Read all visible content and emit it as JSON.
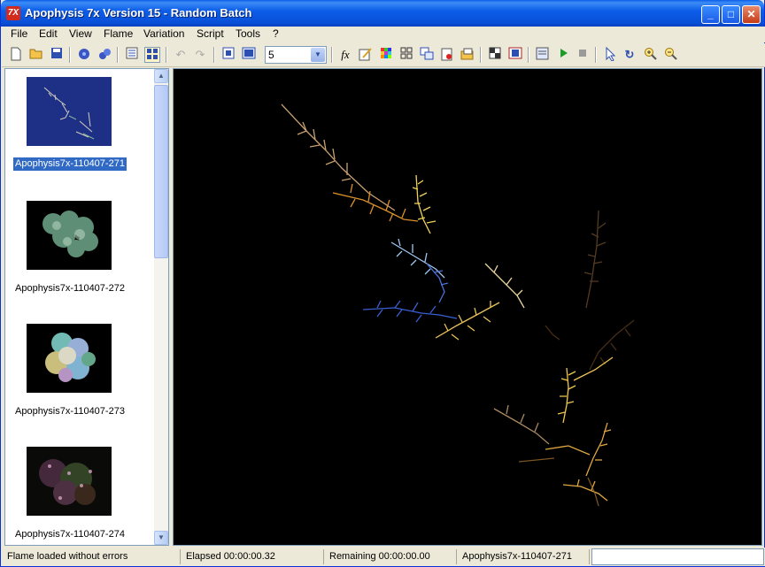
{
  "window": {
    "title": "Apophysis 7x Version 15 - Random Batch",
    "app_icon_text": "7X"
  },
  "titlebar_buttons": {
    "minimize": "_",
    "maximize": "□",
    "close": "✕"
  },
  "menu": [
    "File",
    "Edit",
    "View",
    "Flame",
    "Variation",
    "Script",
    "Tools",
    "?"
  ],
  "toolbar": {
    "icons": [
      "new-icon",
      "open-icon",
      "save-icon",
      "render-icon",
      "render-all-icon",
      "list-view-icon",
      "icon-view-icon",
      "undo-icon",
      "redo-icon",
      "fullscreen-icon",
      "preview-icon",
      "fx-editor-icon",
      "edit-icon",
      "gradient-icon",
      "mutate-icon",
      "adjust-icon",
      "favorites-icon",
      "options-icon",
      "transparency-icon",
      "frame-icon",
      "script-editor-icon",
      "run-script-icon",
      "stop-script-icon",
      "select-icon",
      "rotate-icon",
      "zoom-in-icon",
      "zoom-out-icon"
    ],
    "quality_value": "5"
  },
  "batch": {
    "items": [
      {
        "label": "Apophysis7x-110407-271",
        "selected": true
      },
      {
        "label": "Apophysis7x-110407-272",
        "selected": false
      },
      {
        "label": "Apophysis7x-110407-273",
        "selected": false
      },
      {
        "label": "Apophysis7x-110407-274",
        "selected": false
      }
    ]
  },
  "status": {
    "message": "Flame loaded without errors",
    "elapsed": "Elapsed 00:00:00.32",
    "remaining": "Remaining 00:00:00.00",
    "flame_name": "Apophysis7x-110407-271"
  },
  "colors": {
    "title_blue": "#0a5fe8",
    "selection": "#316ac5",
    "render_bg": "#000000"
  }
}
